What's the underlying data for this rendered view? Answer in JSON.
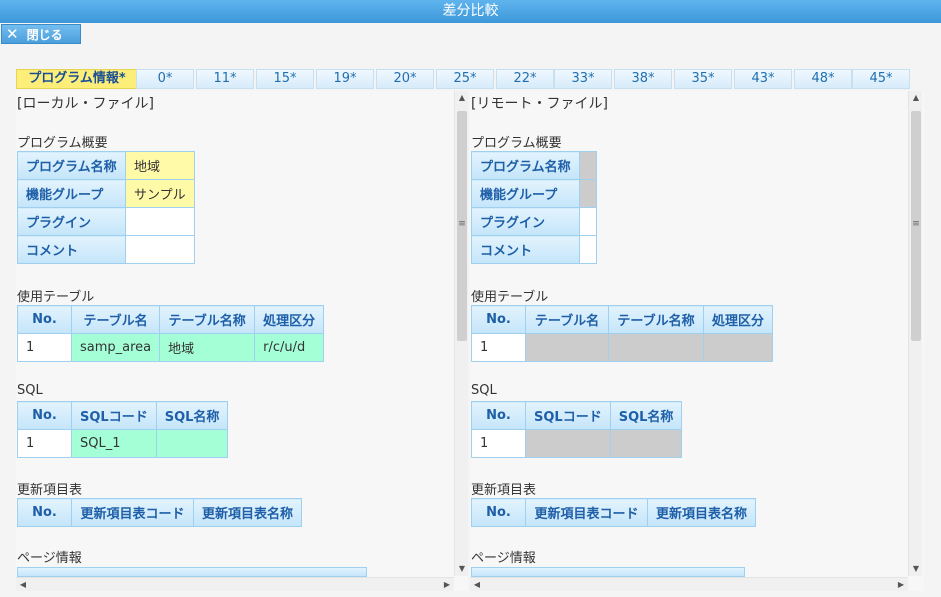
{
  "window": {
    "title": "差分比較"
  },
  "toolbar": {
    "close_label": "閉じる"
  },
  "tabs": [
    {
      "label": "プログラム情報*",
      "active": true
    },
    {
      "label": "0*"
    },
    {
      "label": "11*"
    },
    {
      "label": "15*"
    },
    {
      "label": "19*"
    },
    {
      "label": "20*"
    },
    {
      "label": "25*"
    },
    {
      "label": "22*"
    },
    {
      "label": "33*"
    },
    {
      "label": "38*"
    },
    {
      "label": "35*"
    },
    {
      "label": "43*"
    },
    {
      "label": "48*"
    },
    {
      "label": "45*"
    }
  ],
  "left": {
    "file_title": "[ローカル・ファイル]",
    "overview": {
      "label": "プログラム概要",
      "rows": [
        {
          "key": "プログラム名称",
          "value": "地域"
        },
        {
          "key": "機能グループ",
          "value": "サンプル"
        },
        {
          "key": "プラグイン",
          "value": ""
        },
        {
          "key": "コメント",
          "value": ""
        }
      ]
    },
    "tables": {
      "label": "使用テーブル",
      "headers": [
        "No.",
        "テーブル名",
        "テーブル名称",
        "処理区分"
      ],
      "row": [
        "1",
        "samp_area",
        "地域",
        "r/c/u/d"
      ]
    },
    "sql": {
      "label": "SQL",
      "headers": [
        "No.",
        "SQLコード",
        "SQL名称"
      ],
      "row": [
        "1",
        "SQL_1",
        ""
      ]
    },
    "update": {
      "label": "更新項目表",
      "headers": [
        "No.",
        "更新項目表コード",
        "更新項目表名称"
      ]
    },
    "page": {
      "label": "ページ情報"
    }
  },
  "right": {
    "file_title": "[リモート・ファイル]",
    "overview": {
      "label": "プログラム概要",
      "rows": [
        {
          "key": "プログラム名称",
          "value": ""
        },
        {
          "key": "機能グループ",
          "value": ""
        },
        {
          "key": "プラグイン",
          "value": ""
        },
        {
          "key": "コメント",
          "value": ""
        }
      ]
    },
    "tables": {
      "label": "使用テーブル",
      "headers": [
        "No.",
        "テーブル名",
        "テーブル名称",
        "処理区分"
      ],
      "row": [
        "1",
        "",
        "",
        ""
      ]
    },
    "sql": {
      "label": "SQL",
      "headers": [
        "No.",
        "SQLコード",
        "SQL名称"
      ],
      "row": [
        "1",
        "",
        ""
      ]
    },
    "update": {
      "label": "更新項目表",
      "headers": [
        "No.",
        "更新項目表コード",
        "更新項目表名称"
      ]
    },
    "page": {
      "label": "ページ情報"
    }
  },
  "colors": {
    "titlebar": "#3d97d8",
    "active_tab": "#fdee7a",
    "diff_yellow": "#fffaa8",
    "diff_green": "#a5ffd6",
    "missing_gray": "#cccccc"
  }
}
